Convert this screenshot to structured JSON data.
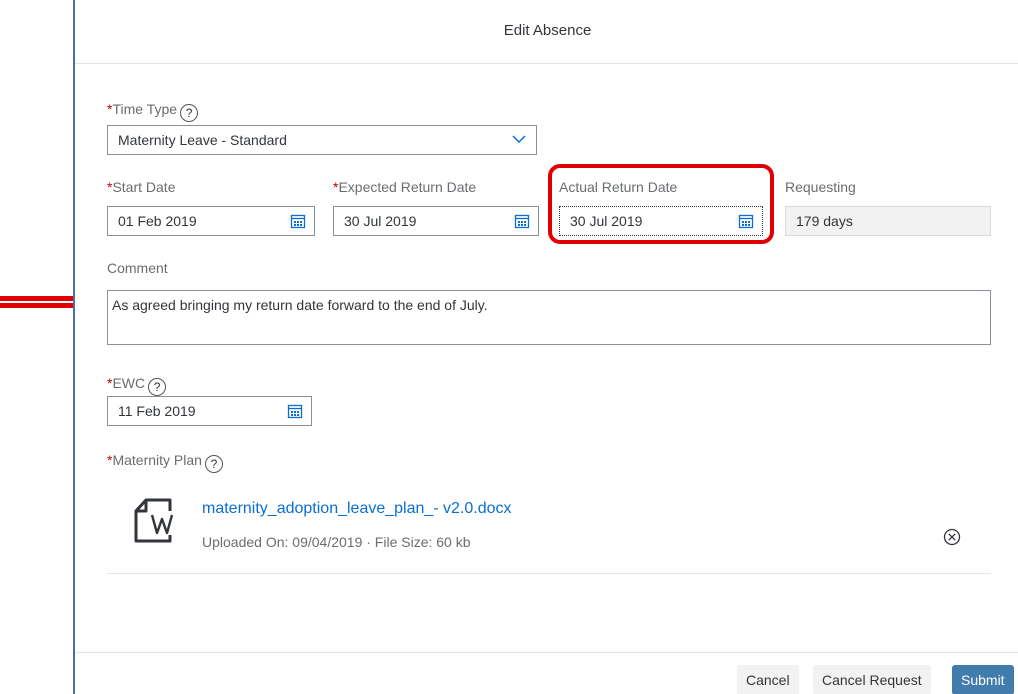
{
  "dialog": {
    "title": "Edit Absence"
  },
  "time_type": {
    "label": "Time Type",
    "value": "Maternity Leave - Standard"
  },
  "start_date": {
    "label": "Start Date",
    "value": "01 Feb 2019"
  },
  "expected_return": {
    "label": "Expected Return Date",
    "value": "30 Jul 2019"
  },
  "actual_return": {
    "label": "Actual Return Date",
    "value": "30 Jul 2019"
  },
  "requesting": {
    "label": "Requesting",
    "value": "179 days"
  },
  "comment": {
    "label": "Comment",
    "value": "As agreed bringing my return date forward to the end of July."
  },
  "ewc": {
    "label": "EWC",
    "value": "11 Feb 2019"
  },
  "maternity_plan": {
    "label": "Maternity Plan",
    "file_name": "maternity_adoption_leave_plan_- v2.0.docx",
    "file_meta": "Uploaded On: 09/04/2019 · File Size: 60 kb"
  },
  "footer": {
    "cancel": "Cancel",
    "cancel_request": "Cancel Request",
    "submit": "Submit"
  },
  "required_marker": "*",
  "help_glyph": "?",
  "icons": [
    "help-icon",
    "calendar-icon",
    "chevron-down-icon",
    "word-document-icon",
    "remove-icon",
    "arrow-right-icon"
  ],
  "colors": {
    "required": "#bb0000",
    "link": "#0a6ed1",
    "primary_button": "#427cac",
    "highlight": "#e00000"
  }
}
